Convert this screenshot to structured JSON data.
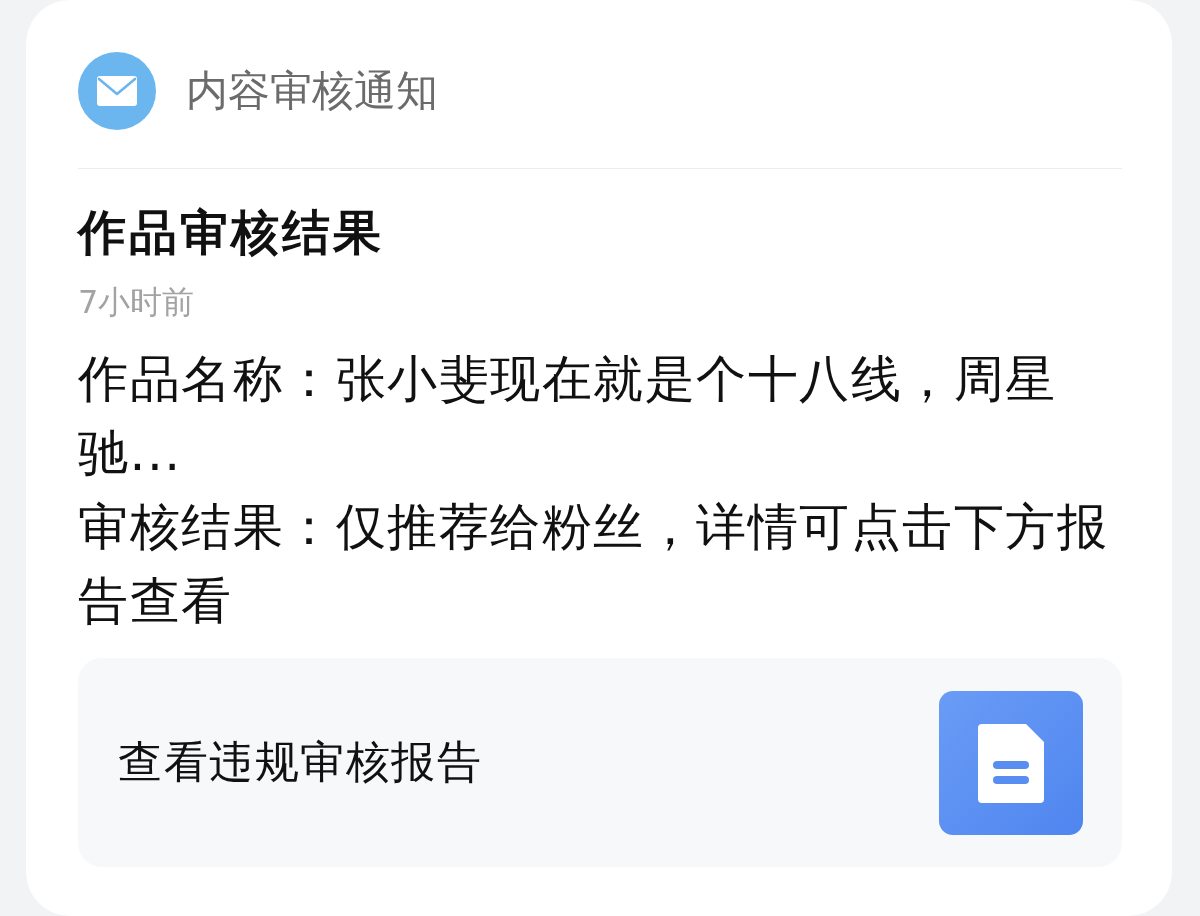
{
  "notification": {
    "category": "内容审核通知",
    "title": "作品审核结果",
    "time": "7小时前",
    "body": [
      "作品名称：张小斐现在就是个十八线，周星驰...",
      "审核结果：仅推荐给粉丝，详情可点击下方报告查看"
    ],
    "report_button": {
      "label": "查看违规审核报告"
    }
  }
}
